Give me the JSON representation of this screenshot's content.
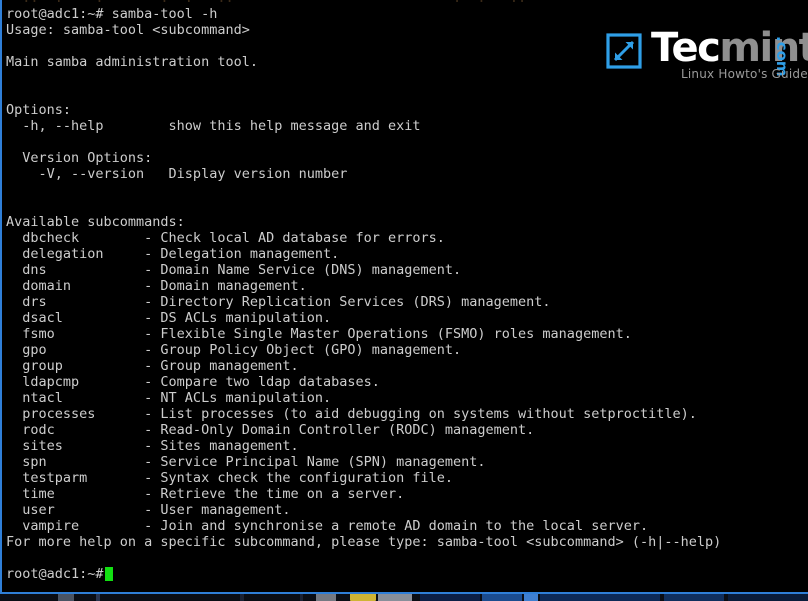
{
  "window": {
    "border_color": "#2f7fd8",
    "background": "#000000",
    "foreground": "#cdcdcd",
    "cursor_color": "#12e012"
  },
  "scrollback_partial": "  ..  .    .       .  .   ..                           .  .   ..",
  "terminal": {
    "lines": [
      "root@adc1:~# samba-tool -h",
      "Usage: samba-tool <subcommand>",
      "",
      "Main samba administration tool.",
      "",
      "",
      "Options:",
      "  -h, --help        show this help message and exit",
      "",
      "  Version Options:",
      "    -V, --version   Display version number",
      "",
      "",
      "Available subcommands:",
      "  dbcheck        - Check local AD database for errors.",
      "  delegation     - Delegation management.",
      "  dns            - Domain Name Service (DNS) management.",
      "  domain         - Domain management.",
      "  drs            - Directory Replication Services (DRS) management.",
      "  dsacl          - DS ACLs manipulation.",
      "  fsmo           - Flexible Single Master Operations (FSMO) roles management.",
      "  gpo            - Group Policy Object (GPO) management.",
      "  group          - Group management.",
      "  ldapcmp        - Compare two ldap databases.",
      "  ntacl          - NT ACLs manipulation.",
      "  processes      - List processes (to aid debugging on systems without setproctitle).",
      "  rodc           - Read-Only Domain Controller (RODC) management.",
      "  sites          - Sites management.",
      "  spn            - Service Principal Name (SPN) management.",
      "  testparm       - Syntax check the configuration file.",
      "  time           - Retrieve the time on a server.",
      "  user           - User management.",
      "  vampire        - Join and synchronise a remote AD domain to the local server.",
      "For more help on a specific subcommand, please type: samba-tool <subcommand> (-h|--help)",
      ""
    ],
    "prompt": "root@adc1:~#"
  },
  "logo": {
    "mark_color": "#2f9fe8",
    "word_primary": "Tec",
    "word_secondary": "mint",
    "domain_suffix": ".com",
    "tagline": "Linux Howto's Guide",
    "primary_color": "#ffffff",
    "secondary_color": "#8f8f8f",
    "tagline_color": "#9a9a9a"
  }
}
